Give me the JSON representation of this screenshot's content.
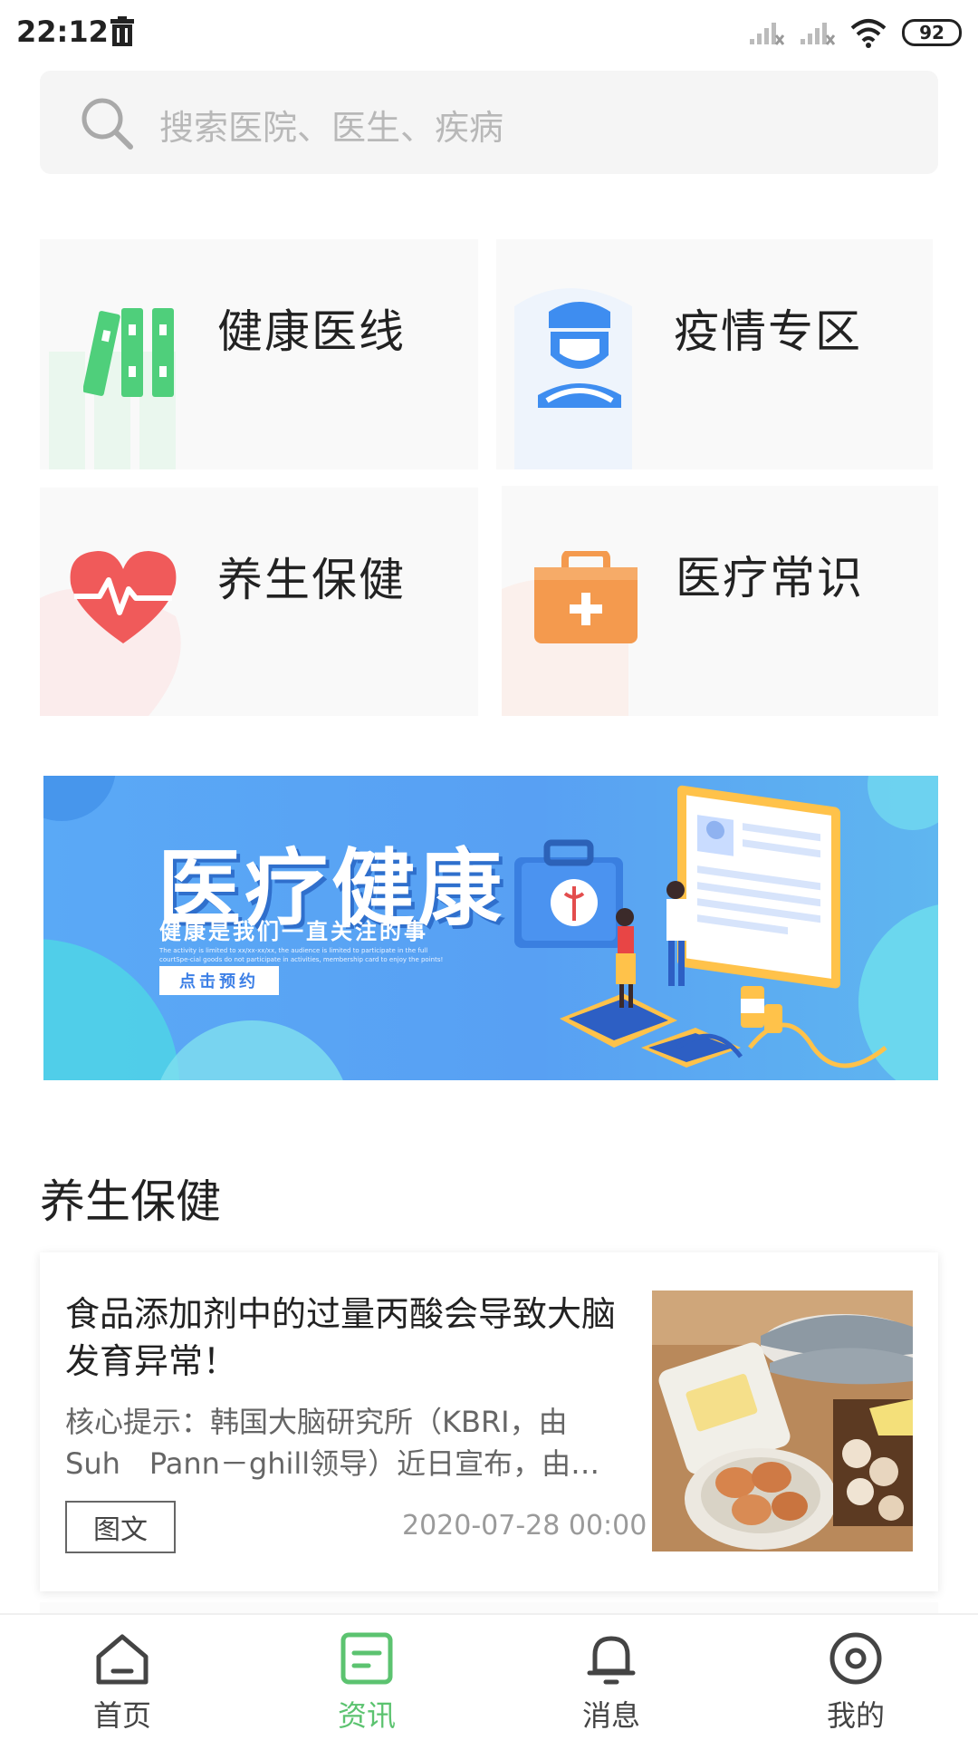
{
  "status_bar": {
    "time": "22:12",
    "battery": "92"
  },
  "search": {
    "placeholder": "搜索医院、医生、疾病"
  },
  "tiles": [
    {
      "label": "健康医线",
      "icon": "folders-icon",
      "color": "#4fcf7b"
    },
    {
      "label": "疫情专区",
      "icon": "masked-doctor-icon",
      "color": "#3e8df0"
    },
    {
      "label": "养生保健",
      "icon": "heart-pulse-icon",
      "color": "#f05a5a"
    },
    {
      "label": "医疗常识",
      "icon": "first-aid-kit-icon",
      "color": "#f49a4e"
    }
  ],
  "banner": {
    "title": "医疗健康",
    "subtitle": "健康是我们一直关注的事",
    "fine_print": "The activity is limited to xx/xx-xx/xx, the audience is limited to participate in the full courtSpe-cial goods do not participate in activities, membership card to enjoy the points!",
    "button": "点击预约"
  },
  "section": {
    "title": "养生保健"
  },
  "article": {
    "title": "食品添加剂中的过量丙酸会导致大脑发育异常！",
    "summary": "核心提示：韩国大脑研究所（KBRI，由Suh　Pann－ghill领导）近日宣布，由…",
    "tag": "图文",
    "date": "2020-07-28 00:00"
  },
  "nav": [
    {
      "label": "首页",
      "icon": "home-icon",
      "active": false
    },
    {
      "label": "资讯",
      "icon": "news-icon",
      "active": true
    },
    {
      "label": "消息",
      "icon": "bell-icon",
      "active": false
    },
    {
      "label": "我的",
      "icon": "profile-icon",
      "active": false
    }
  ],
  "colors": {
    "accent": "#5cc370",
    "text": "#222222",
    "muted": "#9a9a9a"
  }
}
